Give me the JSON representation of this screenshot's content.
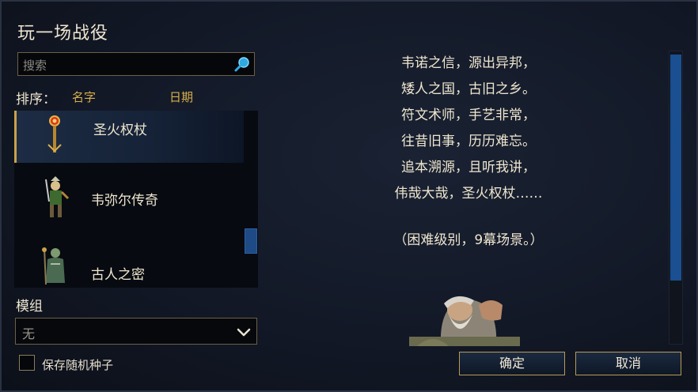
{
  "dialog": {
    "title": "玩一场战役"
  },
  "search": {
    "placeholder": "搜索",
    "icon": "search-icon"
  },
  "sort": {
    "label": "排序：",
    "by_name": "名字",
    "by_date": "日期"
  },
  "campaigns": [
    {
      "name": "圣火权杖",
      "icon": "scepter-icon",
      "selected": true
    },
    {
      "name": "韦弥尔传奇",
      "icon": "warrior-portrait-icon",
      "selected": false
    },
    {
      "name": "古人之密",
      "icon": "ancient-portrait-icon",
      "selected": false
    }
  ],
  "mod": {
    "label": "模组",
    "value": "无"
  },
  "options": {
    "save_random_seed_label": "保存随机种子",
    "save_random_seed_checked": false
  },
  "description": {
    "lines": [
      "韦诺之信，源出异邦，",
      "矮人之国，古旧之乡。",
      "符文术师，手艺非常，",
      "往昔旧事，历历难忘。",
      "追本溯源，且听我讲，",
      "伟哉大哉，圣火权杖……"
    ],
    "difficulty": "（困难级别，9幕场景。）"
  },
  "buttons": {
    "ok": "确定",
    "cancel": "取消"
  },
  "colors": {
    "accent": "#d9b04a",
    "scrollbar": "#1a4f91",
    "border": "#b89a58"
  }
}
